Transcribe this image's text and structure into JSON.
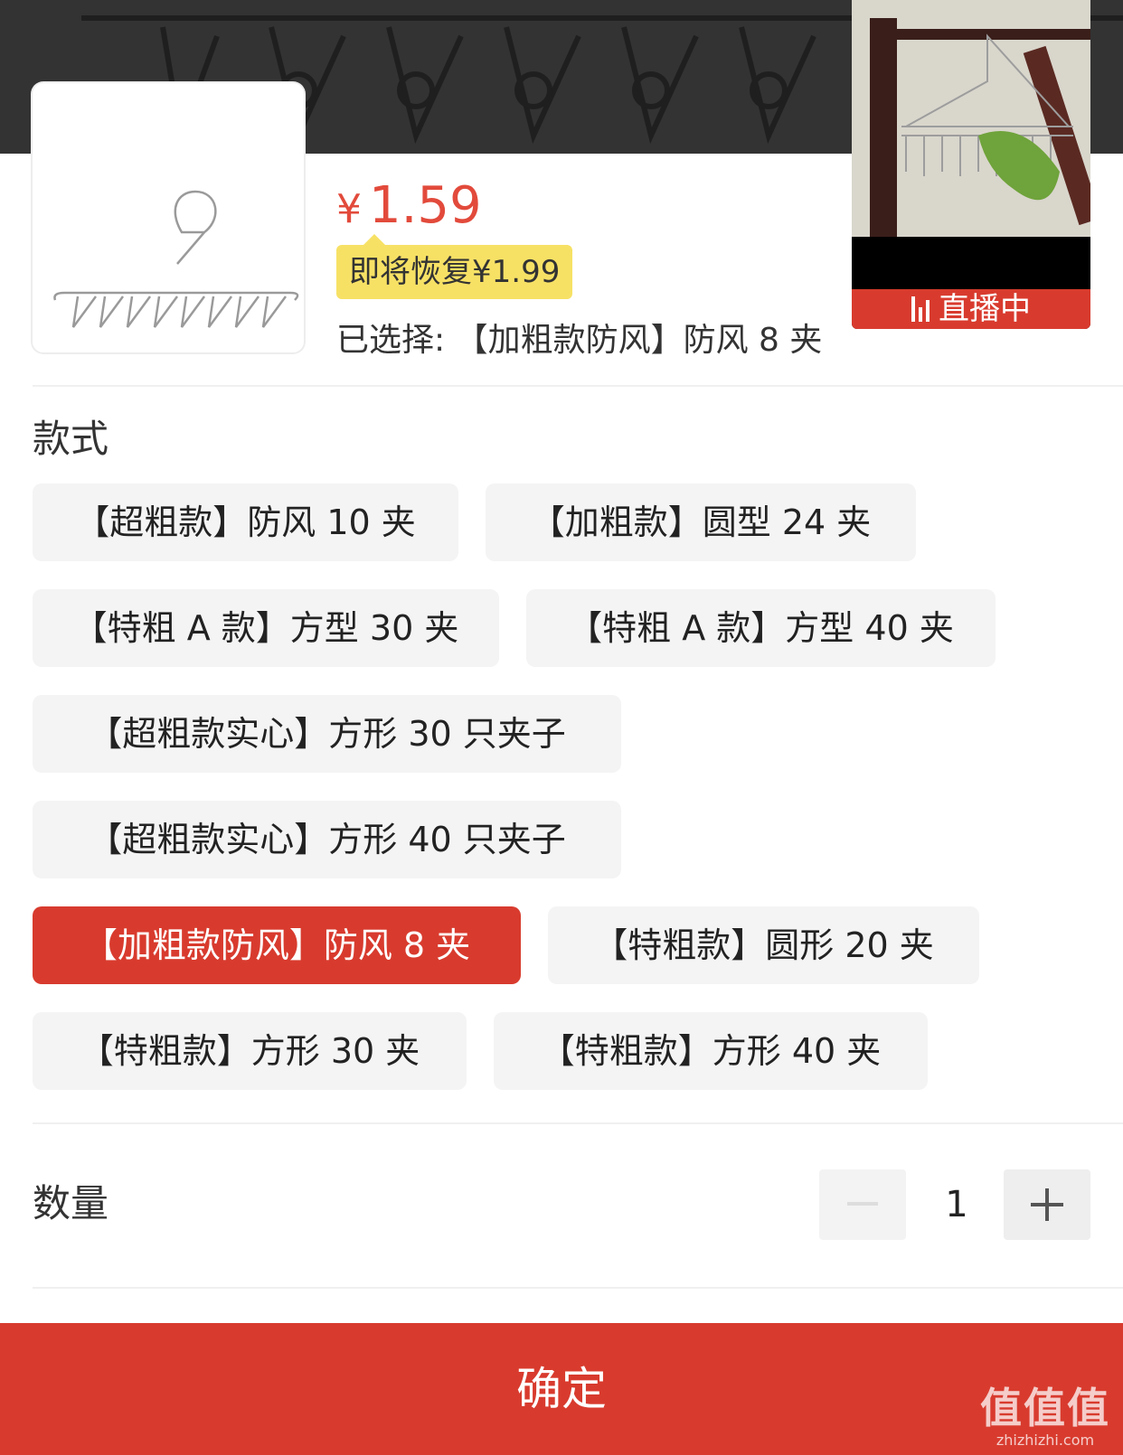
{
  "header": {
    "price_currency": "¥",
    "price_value": "1.59",
    "restore_price_text": "即将恢复¥1.99",
    "selected_text": "已选择: 【加粗款防风】防风 8 夹"
  },
  "live": {
    "badge_text": "直播中"
  },
  "style_section": {
    "title": "款式",
    "options": [
      "【超粗款】防风 10 夹",
      "【加粗款】圆型 24 夹",
      "【特粗 A 款】方型 30 夹",
      "【特粗 A 款】方型 40 夹",
      "【超粗款实心】方形 30 只夹子",
      "【超粗款实心】方形 40 只夹子",
      "【加粗款防风】防风 8 夹",
      "【特粗款】圆形 20 夹",
      "【特粗款】方形 30 夹",
      "【特粗款】方形 40 夹"
    ],
    "selected_index": 6
  },
  "quantity": {
    "label": "数量",
    "value": "1"
  },
  "footer": {
    "confirm_label": "确定"
  },
  "watermark": {
    "brand": "值值值",
    "site": "zhizhizhi.com"
  },
  "colors": {
    "accent": "#d83b2e",
    "price": "#e24a3b",
    "restore_badge": "#f7e165",
    "chip_bg": "#f4f4f4"
  }
}
